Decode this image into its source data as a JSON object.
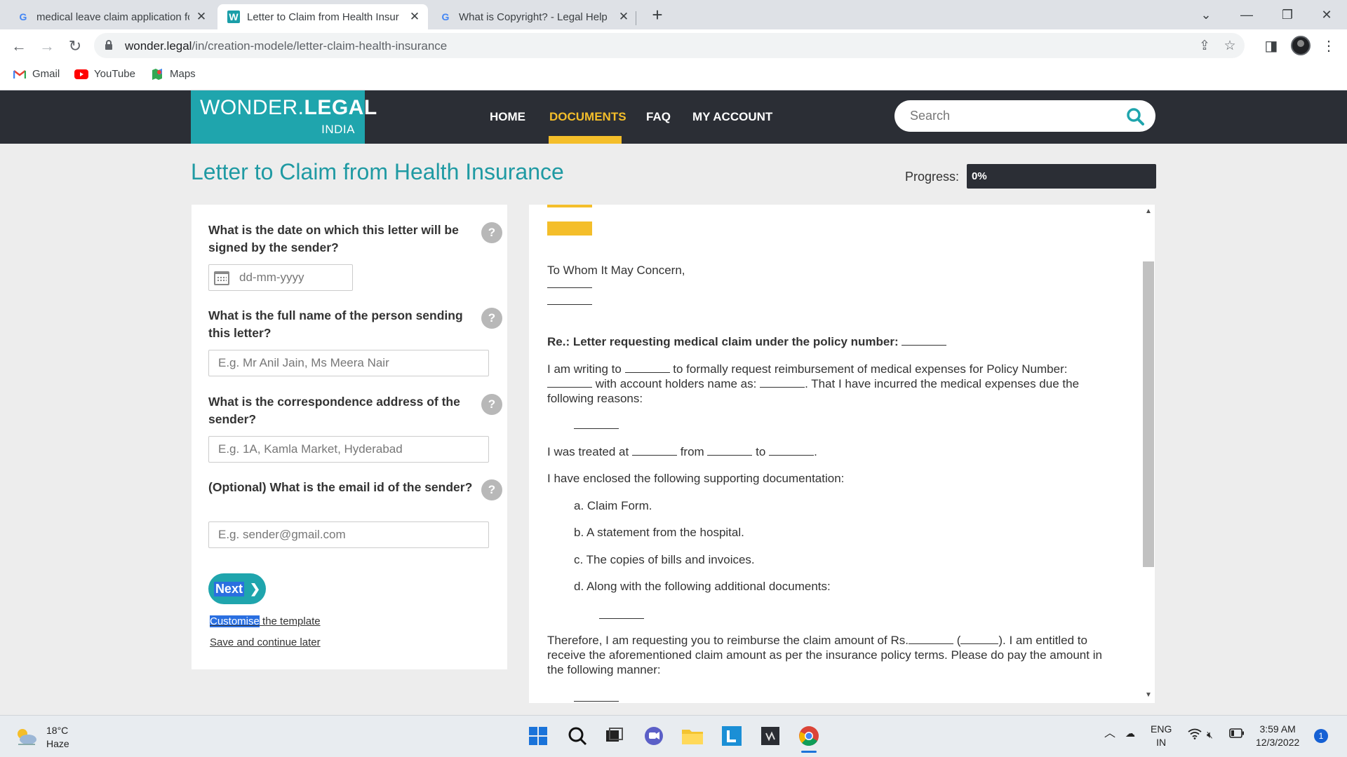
{
  "browser": {
    "tabs": [
      {
        "title": "medical leave claim application fo",
        "icon": "google-icon",
        "active": false
      },
      {
        "title": "Letter to Claim from Health Insur",
        "icon": "wonder-legal-icon",
        "active": true
      },
      {
        "title": "What is Copyright? - Legal Help",
        "icon": "google-icon",
        "active": false
      }
    ],
    "url_host": "wonder.legal",
    "url_path": "/in/creation-modele/letter-claim-health-insurance",
    "bookmarks": [
      {
        "label": "Gmail",
        "icon": "gmail-icon"
      },
      {
        "label": "YouTube",
        "icon": "youtube-icon"
      },
      {
        "label": "Maps",
        "icon": "maps-icon"
      }
    ]
  },
  "site": {
    "logo_prefix": "WONDER.",
    "logo_bold": "LEGAL",
    "logo_country": "INDIA",
    "nav": [
      "HOME",
      "DOCUMENTS",
      "FAQ",
      "MY ACCOUNT"
    ],
    "active_nav": "DOCUMENTS",
    "search_placeholder": "Search"
  },
  "page": {
    "title": "Letter to Claim from Health Insurance",
    "progress_label": "Progress:",
    "progress_value": 0,
    "progress_text": "0%"
  },
  "form": {
    "questions": [
      {
        "text": "What is the date on which this letter will be signed by the sender?",
        "placeholder": "dd-mm-yyyy",
        "type": "date"
      },
      {
        "text": "What is the full name of the person sending this letter?",
        "placeholder": "E.g. Mr Anil Jain, Ms Meera Nair",
        "type": "text"
      },
      {
        "text": "What is the correspondence address of the sender?",
        "placeholder": "E.g. 1A, Kamla Market, Hyderabad",
        "type": "text"
      },
      {
        "text": "(Optional) What is the email id of the sender?",
        "placeholder": "E.g. sender@gmail.com",
        "type": "email"
      }
    ],
    "help_symbol": "?",
    "next_label": "Next",
    "customise_selected": "Customise",
    "customise_rest": " the template",
    "save_later": "Save and continue later"
  },
  "document": {
    "salutation": "To Whom It May Concern,",
    "re_line": "Re.: Letter requesting medical claim under the policy number:",
    "para1_a": "I am writing to",
    "para1_b": "to formally request reimbursement of medical expenses for Policy Number:",
    "para1_c": "with account holders name as:",
    "para1_d": ". That I have incurred the medical expenses due the",
    "para1_e": "following reasons:",
    "treated_a": "I was treated at",
    "treated_b": "from",
    "treated_c": "to",
    "enclosed": "I have enclosed the following supporting documentation:",
    "list": [
      "a. Claim Form.",
      "b. A statement from the hospital.",
      "c. The copies of bills and invoices.",
      "d. Along with the following additional documents:"
    ],
    "therefore_a": "Therefore, I am requesting you to reimburse the claim amount of Rs.",
    "therefore_b": "). I am entitled to",
    "therefore_c": "receive the aforementioned claim amount as per the insurance policy terms. Please do pay the amount in",
    "therefore_d": "the following manner:"
  },
  "taskbar": {
    "temperature": "18°C",
    "weather": "Haze",
    "lang_top": "ENG",
    "lang_bottom": "IN",
    "time": "3:59 AM",
    "date": "12/3/2022",
    "notifications": "1"
  },
  "colors": {
    "brand_teal": "#1fa5ad",
    "header_dark": "#2b2e35",
    "accent_yellow": "#f4be2a"
  }
}
